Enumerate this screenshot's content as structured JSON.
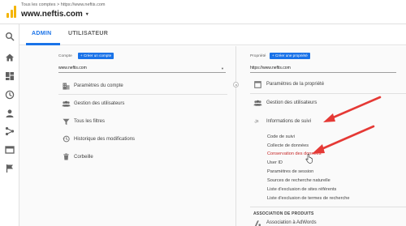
{
  "header": {
    "breadcrumb": "Tous les comptes > https://www.neftis.com",
    "account_title": "www.neftis.com",
    "caret": "▾"
  },
  "rail": {
    "icons": [
      "search-icon",
      "home-icon",
      "dashboard-icon",
      "clock-icon",
      "person-icon",
      "acquisition-icon",
      "behavior-icon",
      "flag-icon"
    ]
  },
  "tabs": {
    "admin": "ADMIN",
    "user": "UTILISATEUR"
  },
  "account_column": {
    "label": "Compte",
    "create_button": "+ Créer un compte",
    "selected": "www.neftis.com",
    "items": [
      {
        "label": "Paramètres du compte",
        "icon": "building-icon"
      },
      {
        "label": "Gestion des utilisateurs",
        "icon": "users-icon"
      },
      {
        "label": "Tous les filtres",
        "icon": "filter-icon"
      },
      {
        "label": "Historique des modifications",
        "icon": "history-icon"
      },
      {
        "label": "Corbeille",
        "icon": "trash-icon"
      }
    ]
  },
  "property_column": {
    "label": "Propriété",
    "create_button": "+ Créer une propriété",
    "selected": "https://www.neftis.com",
    "items": [
      {
        "label": "Paramètres de la propriété",
        "icon": "settings-square-icon"
      },
      {
        "label": "Gestion des utilisateurs",
        "icon": "users-icon"
      },
      {
        "label": "Informations de suivi",
        "icon": "js-icon"
      }
    ],
    "js_glyph": ".js",
    "tracking_sub_items": [
      "Code de suivi",
      "Collecte de données",
      "Conservation des données",
      "User ID",
      "Paramètres de session",
      "Sources de recherche naturelle",
      "Liste d'exclusion de sites référents",
      "Liste d'exclusion de termes de recherche"
    ],
    "highlighted_sub_item": "Conservation des données",
    "section_header": "ASSOCIATION DE PRODUITS",
    "partial_item": "Association à AdWords"
  },
  "colors": {
    "accent": "#1a73e8",
    "annotation_arrow": "#e53935",
    "highlight_text": "#c62828"
  }
}
